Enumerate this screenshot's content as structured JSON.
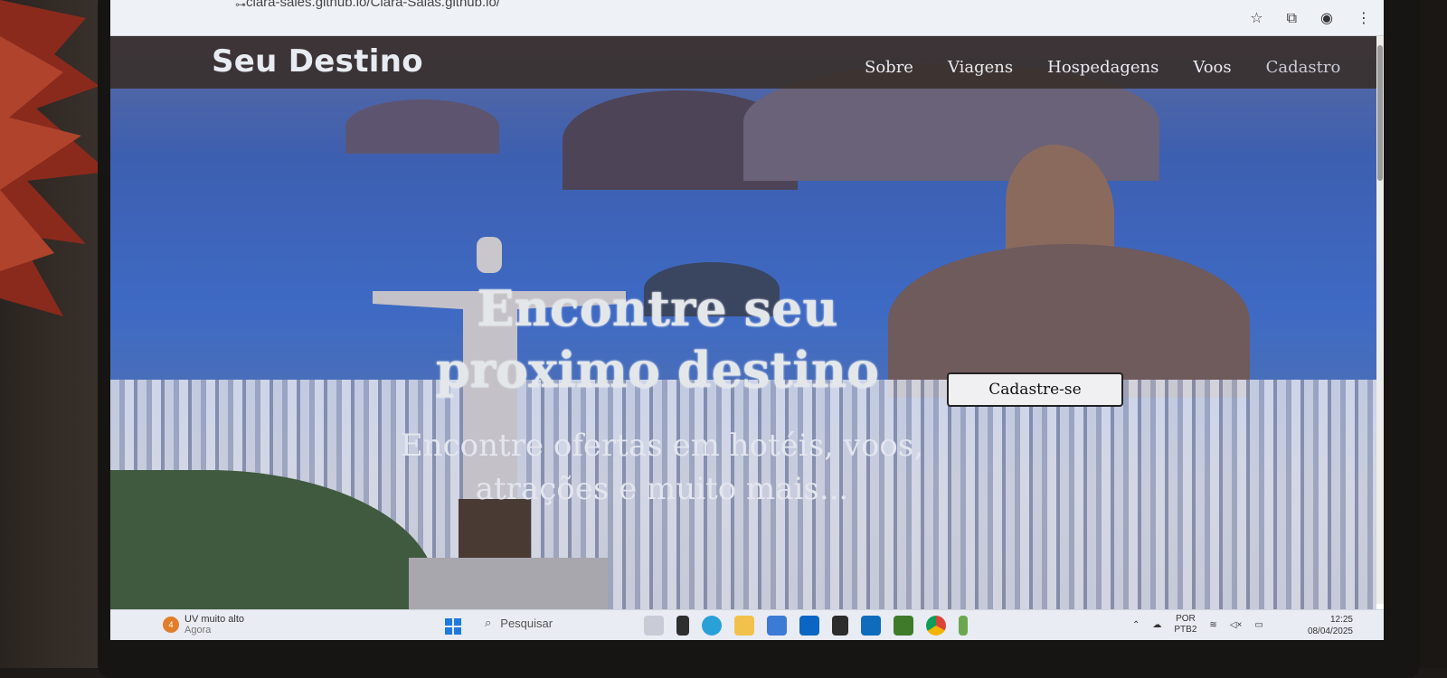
{
  "browser": {
    "url": "clara-sales.github.io/Clara-Salas.github.io/"
  },
  "site": {
    "brand": "Seu Destino",
    "nav": [
      "Sobre",
      "Viagens",
      "Hospedagens",
      "Voos",
      "Cadastro"
    ],
    "hero_title": "Encontre seu proximo destino",
    "hero_subtitle": "Encontre ofertas em hotéis, voos, atrações e muito mais...",
    "cta_label": "Cadastre-se"
  },
  "taskbar": {
    "weather_badge": "4",
    "weather_text": "UV muito alto",
    "weather_sub": "Agora",
    "search_placeholder": "Pesquisar",
    "lang": "POR",
    "layout": "PTB2",
    "time": "12:25",
    "date": "08/04/2025"
  },
  "colors": {
    "nav_bg": "#3a302d",
    "accent": "#1f7ae0"
  }
}
